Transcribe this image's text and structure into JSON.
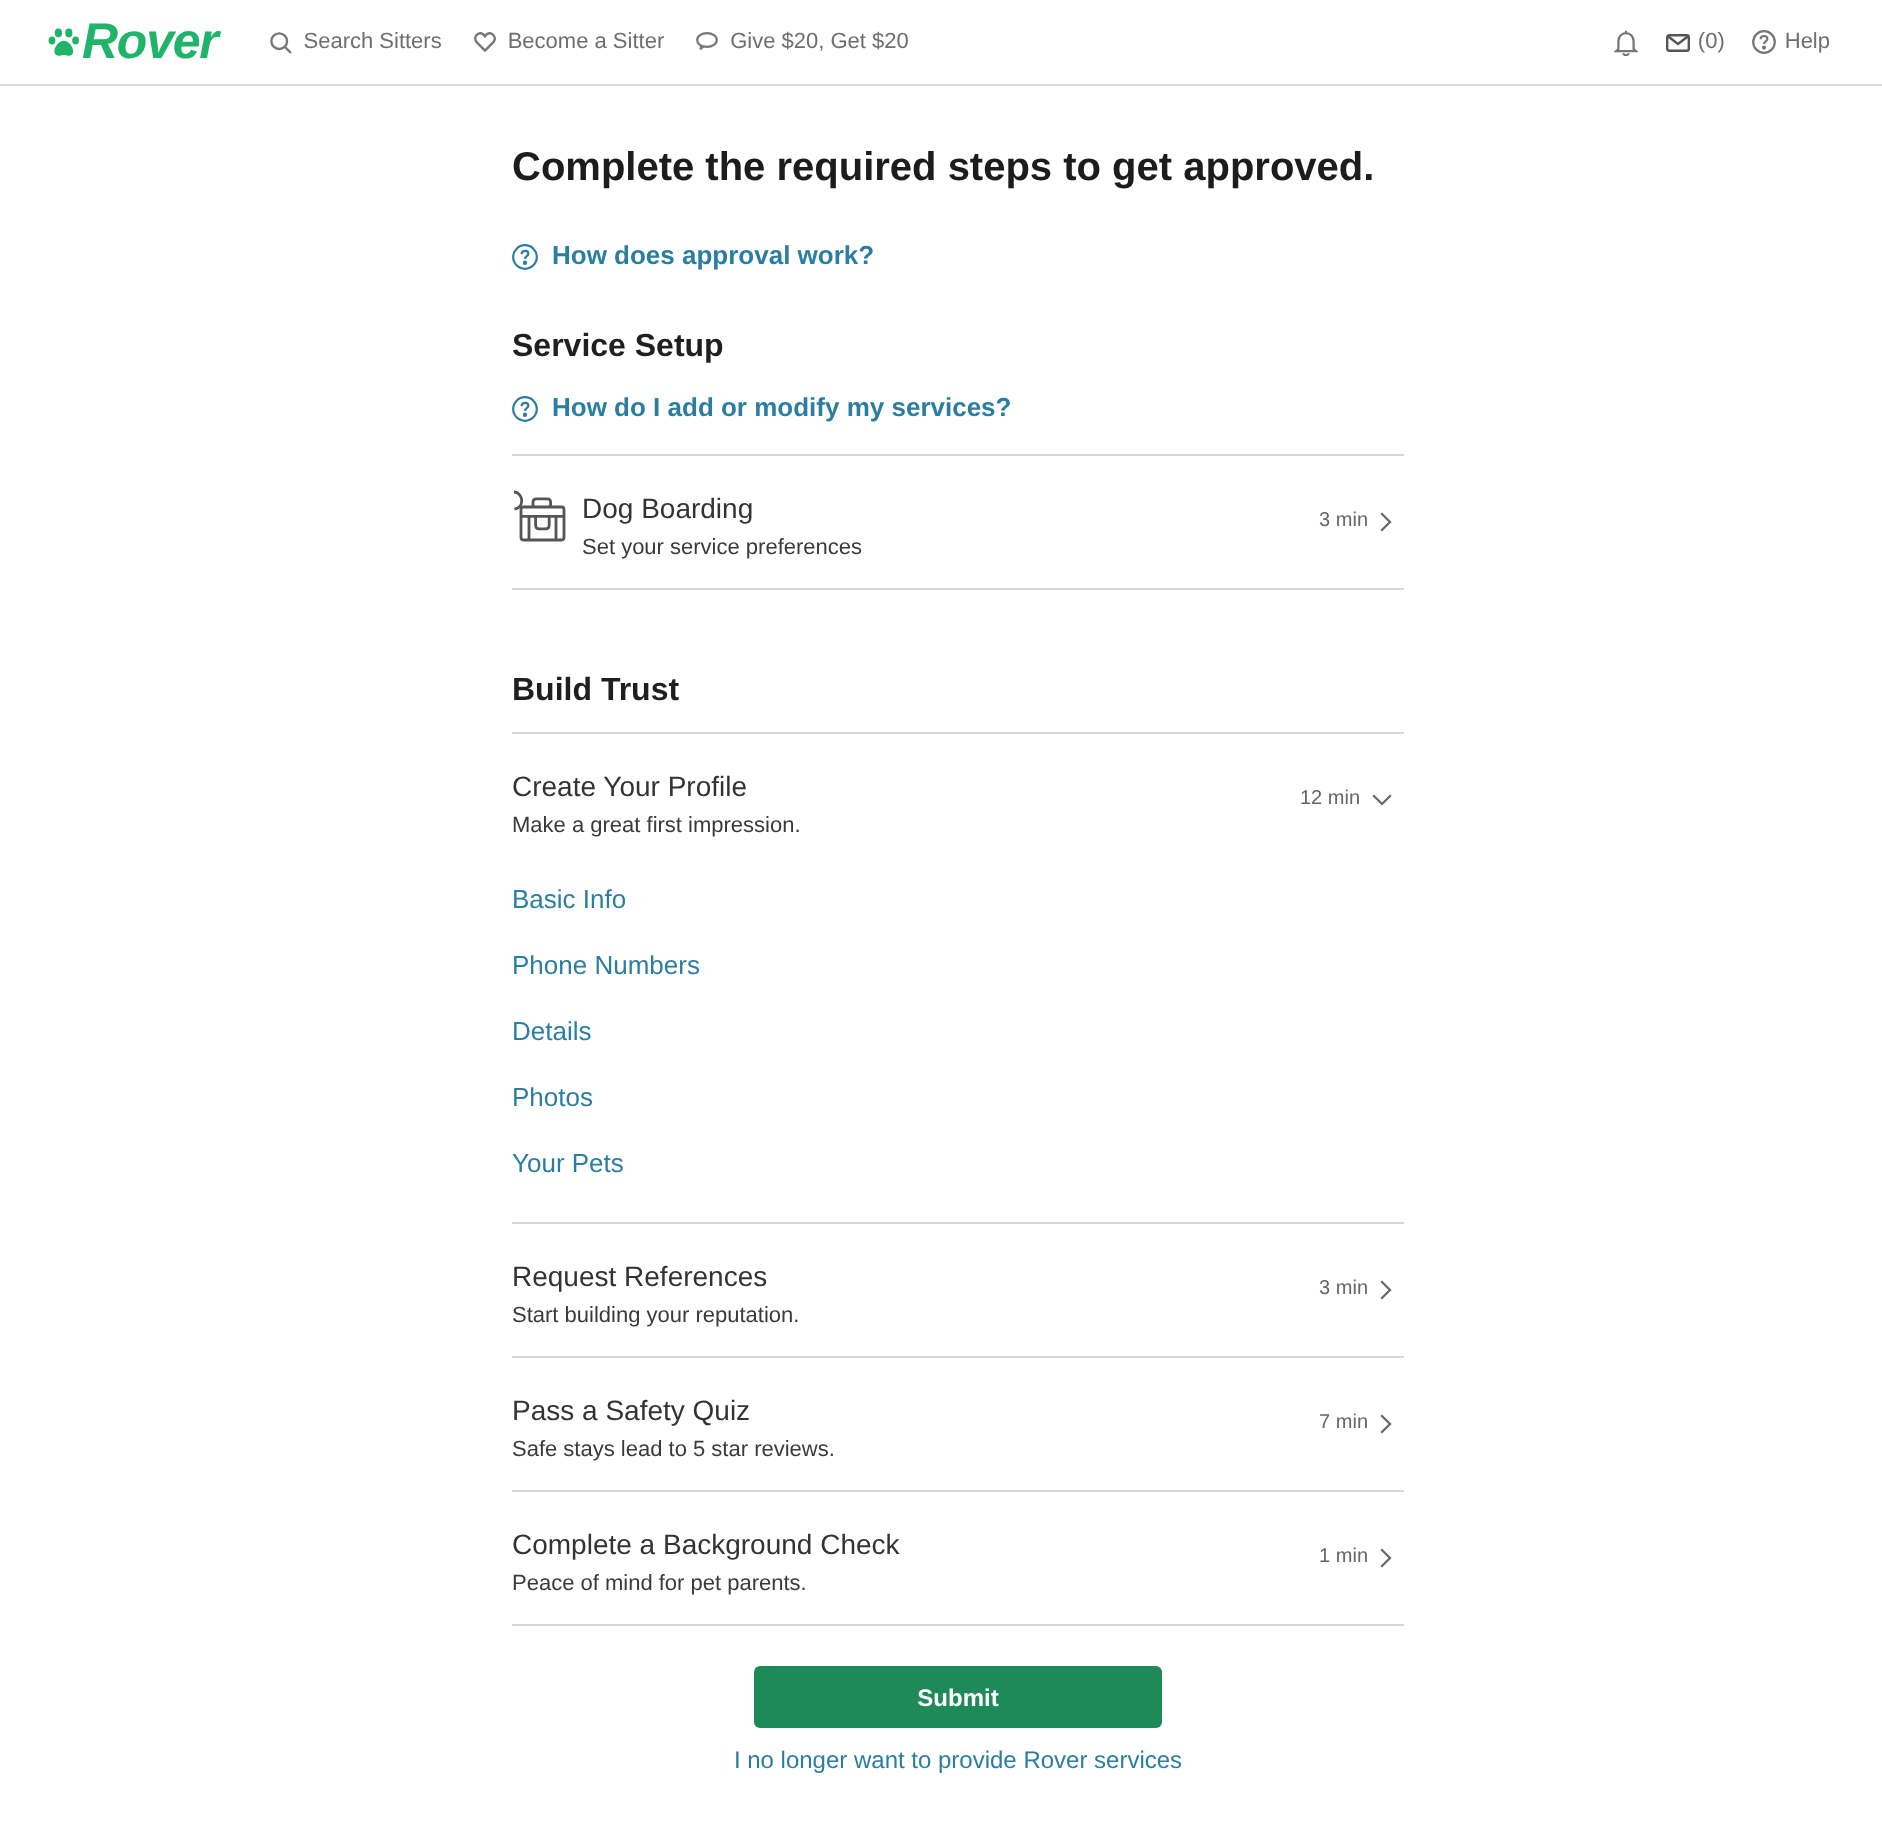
{
  "header": {
    "logo": "Rover",
    "nav_links": [
      {
        "kind": "search",
        "label": "Search Sitters"
      },
      {
        "kind": "heart",
        "label": "Become a Sitter"
      },
      {
        "kind": "chat",
        "label": "Give $20, Get $20"
      }
    ],
    "utility_links": [
      {
        "kind": "bell"
      },
      {
        "kind": "mail",
        "label": "(0)"
      },
      {
        "kind": "help",
        "label": "Help"
      }
    ]
  },
  "heading": "Complete the required steps to get approved.",
  "help_link": "How does approval work?",
  "sections": [
    {
      "title": "Service Setup",
      "help_link": "How do I add or modify my services?",
      "steps": [
        {
          "kind": "service",
          "title": "Dog Boarding",
          "subtitle": "Set your service preferences",
          "time": "3 min",
          "expanded": false
        }
      ]
    },
    {
      "title": "Build Trust",
      "steps": [
        {
          "kind": "task",
          "title": "Create Your Profile",
          "subtitle": "Make a great first impression.",
          "time": "12 min",
          "expanded": true,
          "children": [
            {
              "label": "Basic Info"
            },
            {
              "label": "Phone Numbers"
            },
            {
              "label": "Details"
            },
            {
              "label": "Photos"
            },
            {
              "label": "Your Pets"
            }
          ]
        },
        {
          "kind": "task",
          "title": "Request References",
          "subtitle": "Start building your reputation.",
          "time": "3 min",
          "expanded": false
        },
        {
          "kind": "task",
          "title": "Pass a Safety Quiz",
          "subtitle": "Safe stays lead to 5 star reviews.",
          "time": "7 min",
          "expanded": false
        },
        {
          "kind": "task",
          "title": "Complete a Background Check",
          "subtitle": "Peace of mind for pet parents.",
          "time": "1 min",
          "expanded": false
        }
      ]
    }
  ],
  "submit_button": "Submit",
  "opt_out_link": "I no longer want to provide Rover services"
}
